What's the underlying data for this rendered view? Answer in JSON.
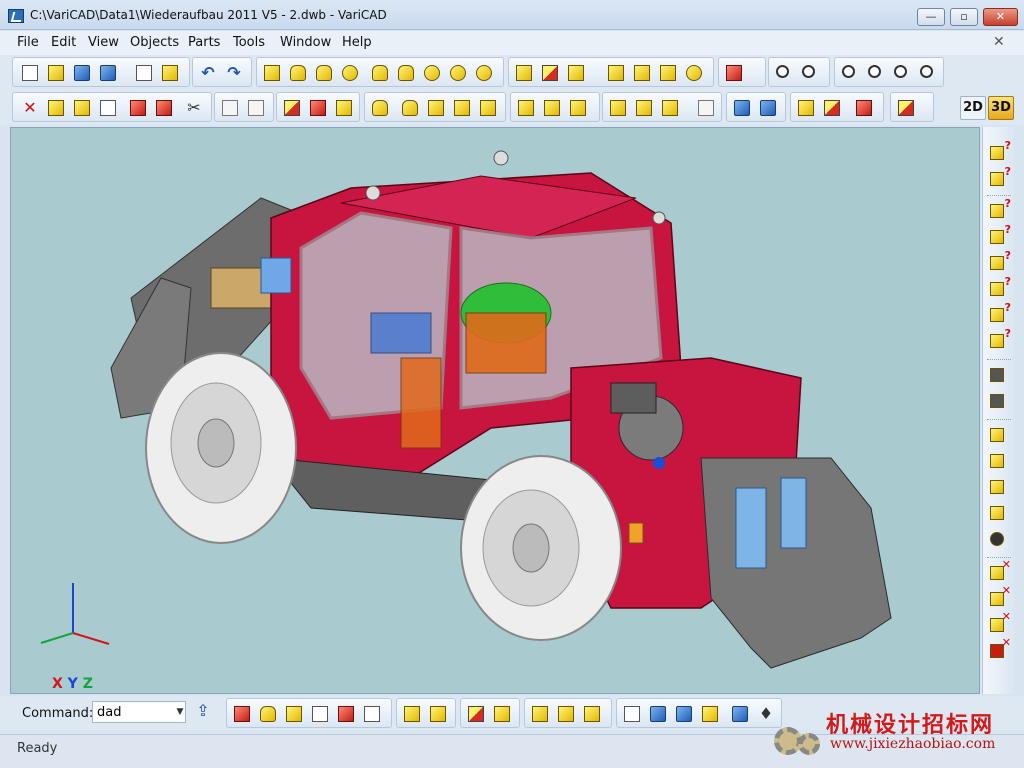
{
  "window": {
    "title": "C:\\VariCAD\\Data1\\Wiederaufbau 2011 V5 - 2.dwb - VariCAD",
    "minimize": "—",
    "maximize": "▫",
    "close": "✕",
    "mdi_close": "✕"
  },
  "menu": [
    "File",
    "Edit",
    "View",
    "Objects",
    "Parts",
    "Tools",
    "Window",
    "Help"
  ],
  "view_mode": {
    "label_2d": "2D",
    "label_3d": "3D",
    "active": "3D"
  },
  "axes": {
    "x": "X",
    "y": "Y",
    "z": "Z"
  },
  "command": {
    "label": "Command:",
    "value": "dad"
  },
  "status": {
    "text": "Ready"
  },
  "watermark": {
    "text": "机械设计招标网",
    "url": "www.jixiezhaobiao.com"
  },
  "colors": {
    "viewport_bg": "#a9cacf",
    "model_body": "#c8153f",
    "tire": "#eeeeee",
    "frame": "#8a8a8a",
    "accent_3d": "#f2b928"
  },
  "toolbar_icons": {
    "row1": [
      "new-file-icon",
      "open-file-icon",
      "save-icon",
      "save-all-icon",
      "copy-icon",
      "paste-icon",
      "undo-icon",
      "redo-icon",
      "box-icon",
      "cylinder-icon",
      "cone-icon",
      "sphere-icon",
      "tube-icon",
      "pipe-elbow-icon",
      "bend-icon",
      "torus-icon",
      "revolve-icon",
      "extrude-icon",
      "move-icon",
      "rotate-icon",
      "solid-icon",
      "profile-icon",
      "wedge-icon",
      "rib-icon",
      "color-box-icon",
      "zoom-window-icon",
      "zoom-fit-icon",
      "zoom-in-icon",
      "zoom-out-icon",
      "zoom-prev-icon",
      "zoom-next-icon"
    ],
    "row2": [
      "delete-icon",
      "transform-icon",
      "move-object-icon",
      "attribute-icon",
      "mirror-icon",
      "array-icon",
      "trim-icon",
      "wireframe-icon",
      "shaded-icon",
      "layer-color-icon",
      "section-icon",
      "cut-icon",
      "drill-icon",
      "thread-icon",
      "chamfer-icon",
      "fillet-icon",
      "boolean-add-icon",
      "boolean-sub-icon",
      "boolean-int-icon",
      "group-icon",
      "ungroup-icon",
      "explode-icon",
      "insert-part-icon",
      "assembly-icon",
      "constraint-icon",
      "kinematics-icon",
      "check-icon",
      "parts-library-icon"
    ],
    "right": [
      "measure-point-icon",
      "measure-distance-icon",
      "measure-angle-icon",
      "measure-coord-icon",
      "measure-edge-icon",
      "measure-surface-icon",
      "measure-volume-icon",
      "measure-mass-icon",
      "check-interference-icon",
      "check-all-icon",
      "move-down-icon",
      "move-up-icon",
      "rotate-part-icon",
      "export-part-icon",
      "refresh-icon",
      "delete-a-icon",
      "delete-b-icon",
      "delete-c-icon",
      "delete-d-icon"
    ],
    "command_bar": [
      "box-solid-icon",
      "cylinder-solid-icon",
      "profile-l-icon",
      "section-view-icon",
      "section-detail-icon",
      "section-cut-icon",
      "edit-solid-icon",
      "edit-group-icon",
      "attributes-icon",
      "add-part-icon",
      "query-icon",
      "settings-icon",
      "mass-icon",
      "bom-icon",
      "structure-icon",
      "links-icon",
      "verify-icon",
      "snap-icon",
      "light-icon"
    ]
  }
}
